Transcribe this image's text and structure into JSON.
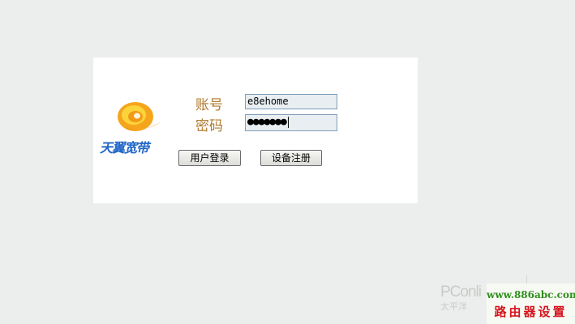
{
  "logo": {
    "text": "天翼宽带",
    "icon": "tianyi-swirl-logo",
    "colors": {
      "swirl_orange": "#f29a18",
      "swirl_yellow": "#f9cf2a",
      "text_blue": "#1f66c8"
    }
  },
  "form": {
    "account_label": "账号",
    "account_value": "e8ehome",
    "password_label": "密码",
    "password_masked": "●●●●●●●",
    "login_button": "用户登录",
    "register_button": "设备注册"
  },
  "watermarks": {
    "pconline_big": "PConli",
    "pconline_small": "太平洋",
    "site_url": "www.886abc.com",
    "site_title": "路由器设置"
  },
  "colors": {
    "background": "#eceeed",
    "panel": "#ffffff",
    "label_text": "#b07a2e",
    "input_fill": "#e8eef2",
    "input_border": "#7f9db9"
  }
}
